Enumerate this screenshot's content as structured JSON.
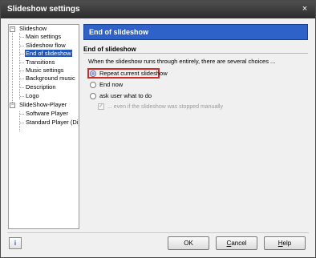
{
  "window": {
    "title": "Slideshow settings",
    "close_icon": "×"
  },
  "tree": {
    "root1": {
      "label": "Slideshow",
      "toggle": "−"
    },
    "root1_children": [
      {
        "label": "Main settings"
      },
      {
        "label": "Slideshow flow"
      },
      {
        "label": "End of slideshow",
        "selected": true
      },
      {
        "label": "Transitions"
      },
      {
        "label": "Music settings"
      },
      {
        "label": "Background music"
      },
      {
        "label": "Description"
      },
      {
        "label": "Logo"
      }
    ],
    "root2": {
      "label": "SlideShow-Player",
      "toggle": "−"
    },
    "root2_children": [
      {
        "label": "Software Player"
      },
      {
        "label": "Standard Player (Di..."
      }
    ]
  },
  "content": {
    "header": "End of slideshow",
    "group_title": "End of slideshow",
    "description": "When the slideshow runs through entirely, there are several choices ...",
    "options": [
      {
        "label": "Repeat current slideshow",
        "checked": true
      },
      {
        "label": "End now",
        "checked": false
      },
      {
        "label": "ask user what to do",
        "checked": false
      }
    ],
    "checkbox": {
      "label": "... even if the slideshow was stopped manually",
      "checked": true,
      "mark": "✓"
    }
  },
  "footer": {
    "info_icon": "i",
    "ok": "OK",
    "cancel_first": "C",
    "cancel_rest": "ancel",
    "help_first": "H",
    "help_rest": "elp"
  },
  "colors": {
    "header_bg": "#2f62c9",
    "selection": "#1f58b8",
    "highlight": "#d22a2a"
  }
}
